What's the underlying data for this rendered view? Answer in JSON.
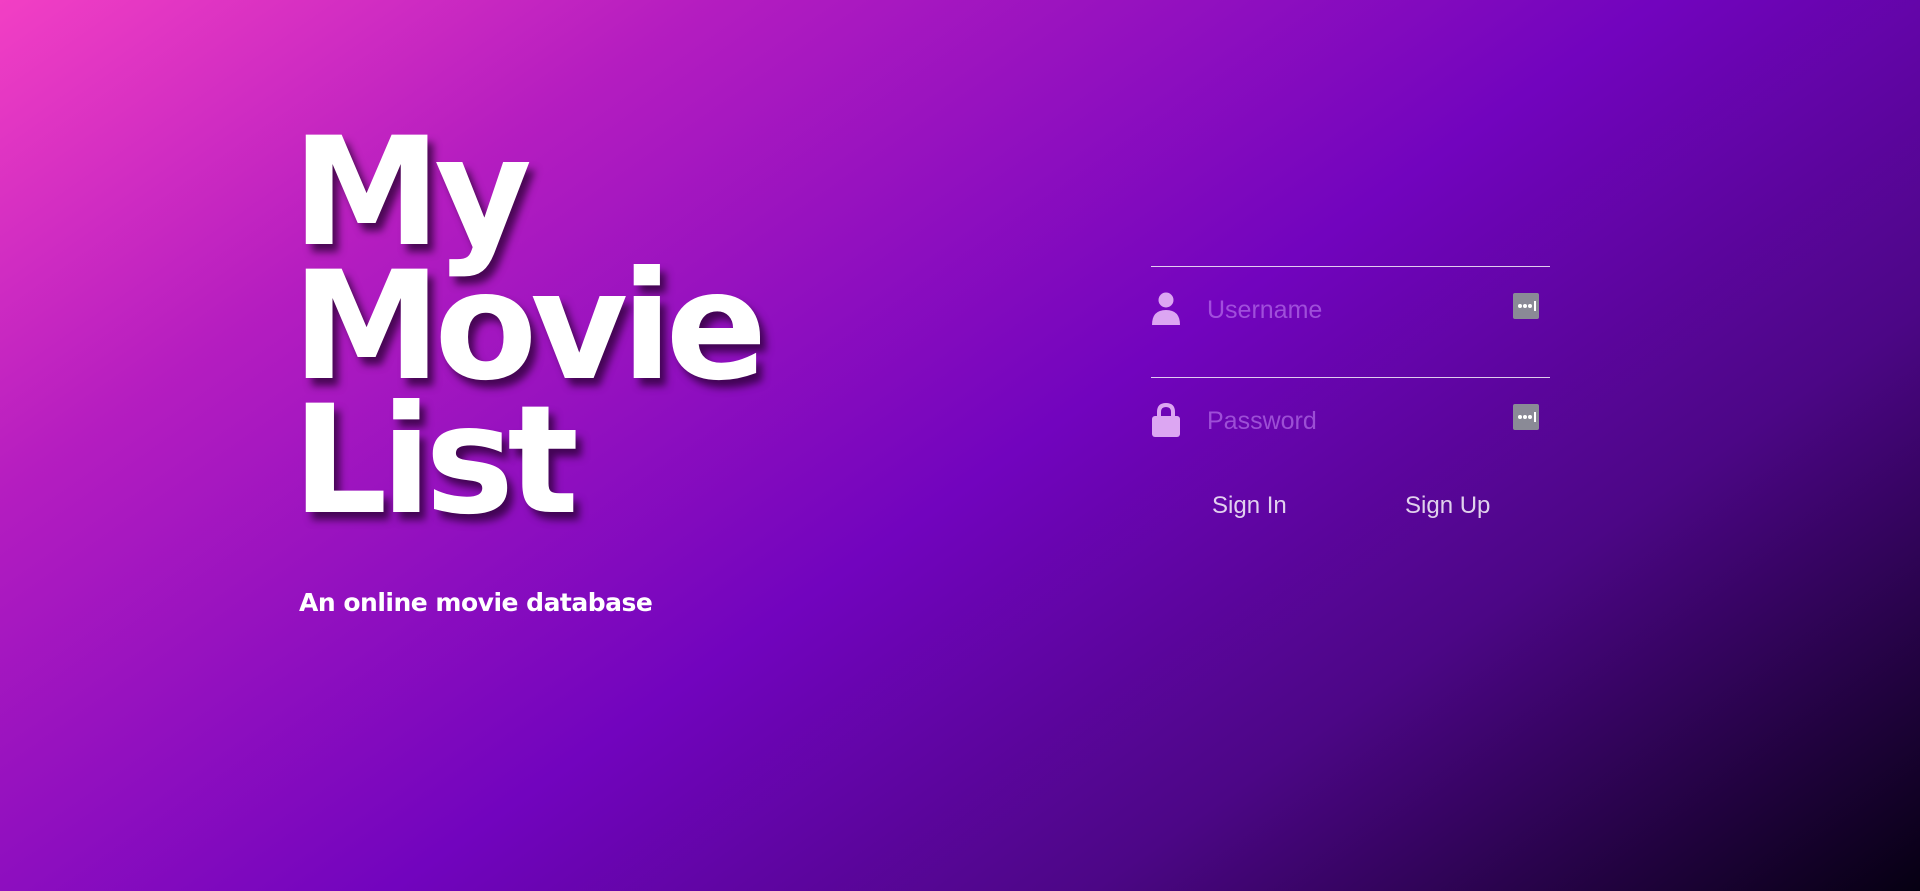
{
  "brand": {
    "title_lines": [
      "My",
      "Movie",
      "List"
    ],
    "tagline": "An online movie database"
  },
  "login": {
    "username": {
      "placeholder": "Username",
      "value": "",
      "icon": "user-icon"
    },
    "password": {
      "placeholder": "Password",
      "value": "",
      "icon": "lock-icon"
    },
    "password_manager_icon": "password-manager-key-icon",
    "sign_in_label": "Sign In",
    "sign_up_label": "Sign Up"
  },
  "colors": {
    "gradient_start": "#f23fc4",
    "gradient_mid": "#7204be",
    "gradient_end": "#060012",
    "icon_color": "#dca6f2",
    "text": "#ffffff"
  }
}
